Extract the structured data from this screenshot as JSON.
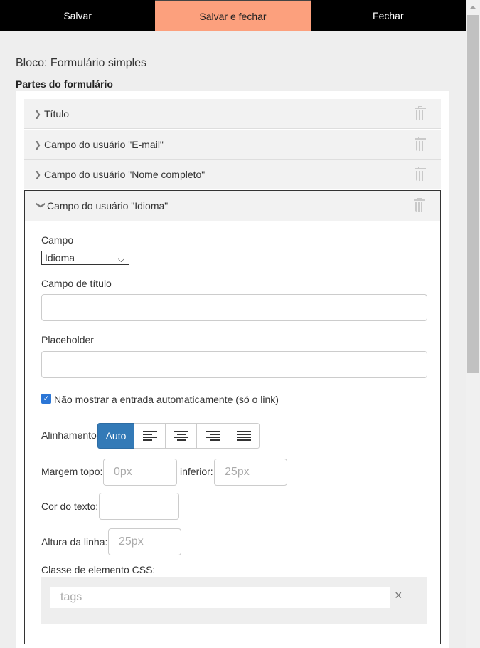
{
  "toolbar": {
    "save": "Salvar",
    "save_close": "Salvar e fechar",
    "close": "Fechar"
  },
  "block_title": "Bloco: Formulário simples",
  "parts_title": "Partes do formulário",
  "parts": [
    {
      "label": "Título",
      "expanded": false
    },
    {
      "label": "Campo do usuário \"E-mail\"",
      "expanded": false
    },
    {
      "label": "Campo do usuário \"Nome completo\"",
      "expanded": false
    },
    {
      "label": "Campo do usuário \"Idioma\"",
      "expanded": true
    }
  ],
  "editor": {
    "field_label": "Campo",
    "field_value": "Idioma",
    "title_field_label": "Campo de título",
    "title_field_value": "",
    "placeholder_label": "Placeholder",
    "placeholder_value": "",
    "checkbox_label": "Não mostrar a entrada automaticamente (só o link)",
    "checkbox_checked": true,
    "alignment_label": "Alinhamento",
    "alignment_auto": "Auto",
    "alignment_options": [
      "left-align-icon",
      "center-align-icon",
      "right-align-icon",
      "justify-align-icon"
    ],
    "margin_top_label": "Margem topo:",
    "margin_top_placeholder": "0px",
    "margin_bottom_label": "inferior:",
    "margin_bottom_placeholder": "25px",
    "text_color_label": "Cor do texto:",
    "line_height_label": "Altura da linha:",
    "line_height_placeholder": "25px",
    "css_class_label": "Classe de elemento CSS:",
    "tags_placeholder": "tags",
    "tags_clear": "×"
  },
  "colors": {
    "accent": "#fca07d",
    "toolbar_bg": "#000000",
    "active_blue": "#337ab7",
    "checkbox": "#2b76d6"
  }
}
